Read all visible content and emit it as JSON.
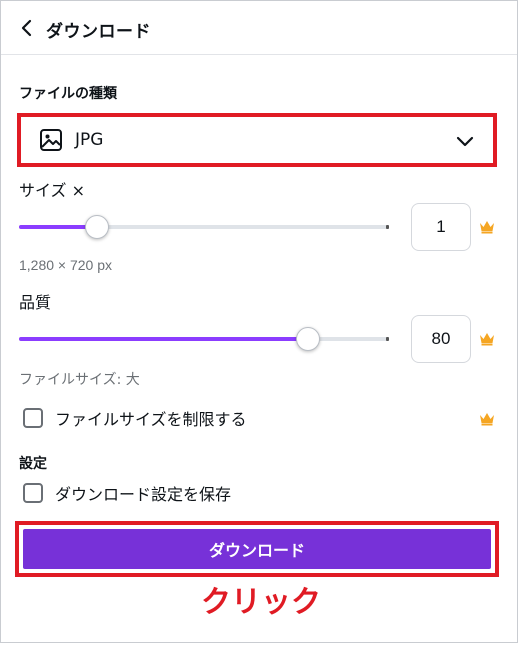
{
  "header": {
    "title": "ダウンロード",
    "back_icon": "chevron-left-icon"
  },
  "file_type": {
    "label": "ファイルの種類",
    "selected": "JPG",
    "icon": "image-icon"
  },
  "size": {
    "label": "サイズ ×",
    "value": "1",
    "slider_fraction": 0.21,
    "dimensions": "1,280 × 720 px"
  },
  "quality": {
    "label": "品質",
    "value": "80",
    "slider_fraction": 0.78,
    "file_size": "ファイルサイズ: 大"
  },
  "limit_file_size": {
    "label": "ファイルサイズを制限する",
    "checked": false
  },
  "settings": {
    "label": "設定",
    "save_label": "ダウンロード設定を保存",
    "checked": false
  },
  "download_button": {
    "label": "ダウンロード"
  },
  "annotation": {
    "text": "クリック"
  },
  "colors": {
    "accent": "#8b3dff",
    "button": "#7731d8",
    "highlight": "#e01b24",
    "crown": "#f5a623"
  }
}
